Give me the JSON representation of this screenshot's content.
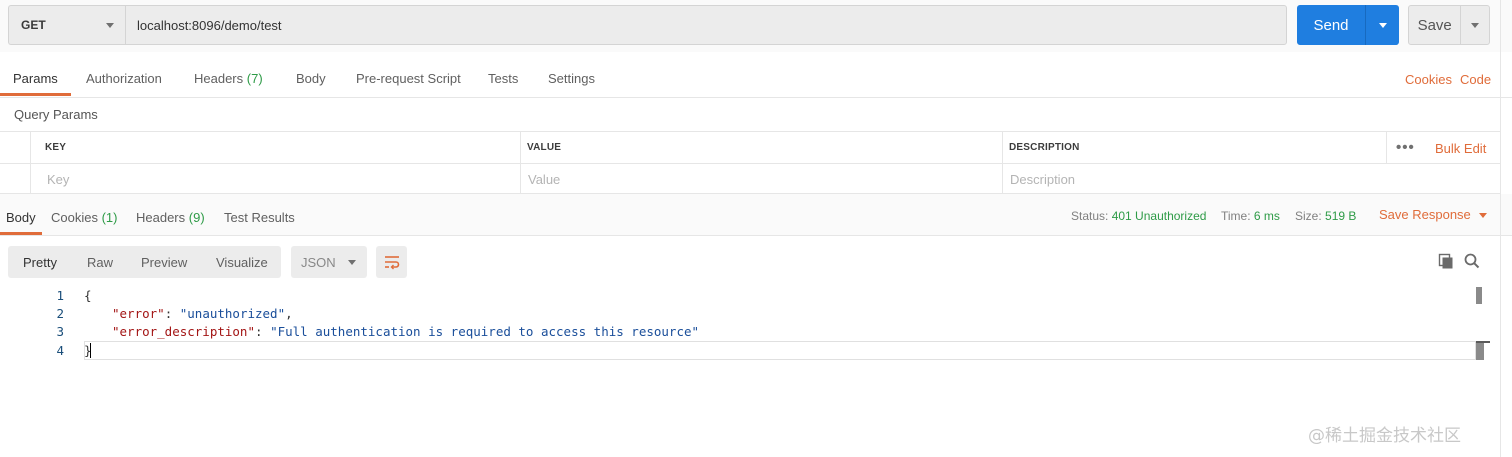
{
  "request": {
    "method": "GET",
    "url": "localhost:8096/demo/test",
    "send_label": "Send",
    "save_label": "Save"
  },
  "request_tabs": [
    {
      "label": "Params",
      "count": ""
    },
    {
      "label": "Authorization",
      "count": ""
    },
    {
      "label": "Headers",
      "count": "(7)"
    },
    {
      "label": "Body",
      "count": ""
    },
    {
      "label": "Pre-request Script",
      "count": ""
    },
    {
      "label": "Tests",
      "count": ""
    },
    {
      "label": "Settings",
      "count": ""
    }
  ],
  "right_links": {
    "cookies": "Cookies",
    "code": "Code"
  },
  "query_params": {
    "title": "Query Params",
    "columns": [
      "KEY",
      "VALUE",
      "DESCRIPTION"
    ],
    "placeholders": [
      "Key",
      "Value",
      "Description"
    ],
    "more": "•••",
    "bulk_edit": "Bulk Edit"
  },
  "response_tabs": [
    {
      "label": "Body",
      "count": ""
    },
    {
      "label": "Cookies",
      "count": "(1)"
    },
    {
      "label": "Headers",
      "count": "(9)"
    },
    {
      "label": "Test Results",
      "count": ""
    }
  ],
  "response_meta": {
    "status_label": "Status:",
    "status_value": "401 Unauthorized",
    "time_label": "Time:",
    "time_value": "6 ms",
    "size_label": "Size:",
    "size_value": "519 B",
    "save_response": "Save Response"
  },
  "view_modes": [
    "Pretty",
    "Raw",
    "Preview",
    "Visualize"
  ],
  "format": "JSON",
  "code_lines": [
    {
      "n": "1",
      "text": "{"
    },
    {
      "n": "2",
      "key": "\"error\"",
      "sep": ": ",
      "value": "\"unauthorized\"",
      "end": ","
    },
    {
      "n": "3",
      "key": "\"error_description\"",
      "sep": ": ",
      "value": "\"Full authentication is required to access this resource\"",
      "end": ""
    },
    {
      "n": "4",
      "text": "}"
    }
  ],
  "watermark": "@稀土掘金技术社区",
  "colors": {
    "accent": "#e06c3a",
    "send": "#1f7ee0",
    "success_green": "#2e9b47"
  }
}
